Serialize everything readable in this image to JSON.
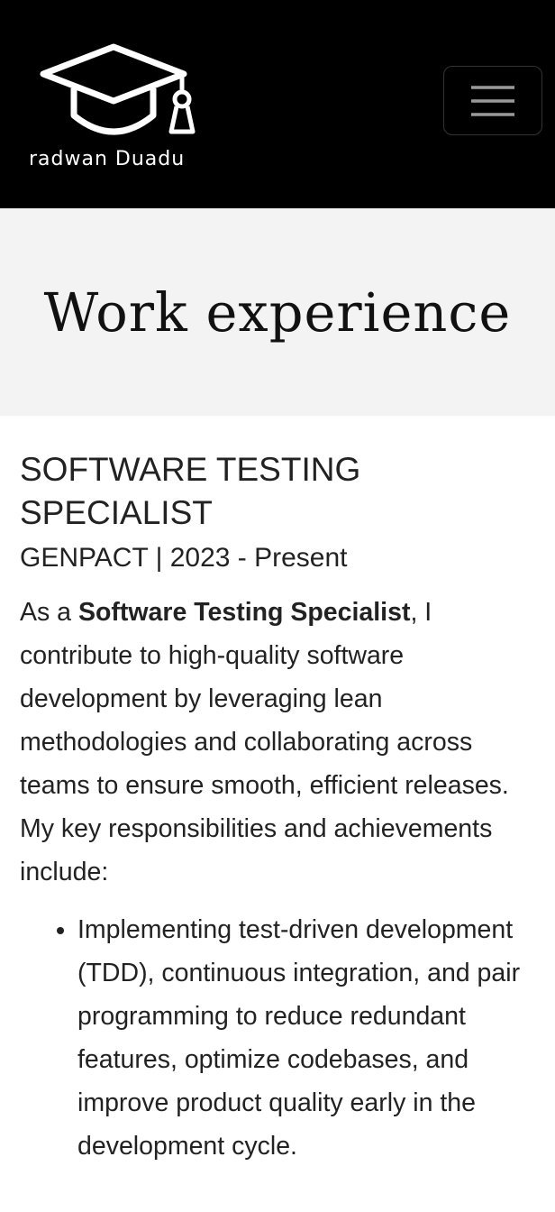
{
  "navbar": {
    "brand_name": "radwan Duadu",
    "logo_icon": "graduation-cap-icon",
    "menu_icon": "hamburger-menu-icon",
    "background_color": "#000000"
  },
  "header": {
    "title": "Work experience",
    "background_color": "#f3f3f3"
  },
  "job": {
    "title": "SOFTWARE TESTING SPECIALIST",
    "company_line": "GENPACT | 2023 - Present",
    "intro_prefix": "As a ",
    "intro_role": "Software Testing Specialist",
    "intro_rest": ", I contribute to high-quality software development by leveraging lean methodologies and collaborating across teams to ensure smooth, efficient releases. My key responsibilities and achievements include:",
    "responsibilities": [
      "Implementing test-driven development (TDD), continuous integration, and pair programming to reduce redundant features, optimize codebases, and improve product quality early in the development cycle."
    ]
  }
}
